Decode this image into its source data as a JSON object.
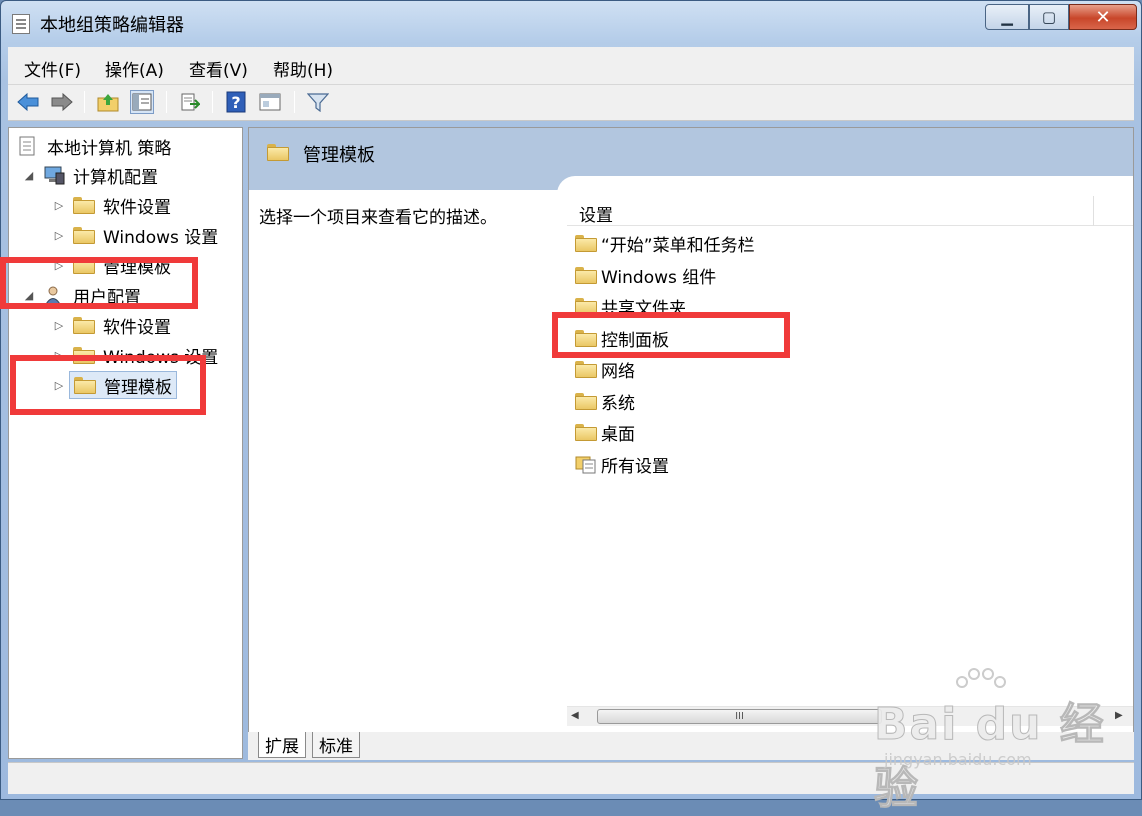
{
  "window": {
    "title": "本地组策略编辑器",
    "minimize_glyph": "▁",
    "maximize_glyph": "▢",
    "close_glyph": "✕"
  },
  "menubar": {
    "items": [
      "文件(F)",
      "操作(A)",
      "查看(V)",
      "帮助(H)"
    ]
  },
  "toolbar": {
    "icons": [
      "back-arrow-icon",
      "forward-arrow-icon",
      "up-folder-icon",
      "show-hide-tree-icon",
      "export-list-icon",
      "help-icon",
      "properties-icon",
      "filter-icon"
    ]
  },
  "tree": {
    "root": "本地计算机 策略",
    "computer_config": "计算机配置",
    "computer_children": [
      "软件设置",
      "Windows 设置",
      "管理模板"
    ],
    "user_config": "用户配置",
    "user_children": [
      "软件设置",
      "Windows 设置",
      "管理模板"
    ]
  },
  "details": {
    "header_title": "管理模板",
    "description": "选择一个项目来查看它的描述。",
    "column_header": "设置",
    "items": [
      "“开始”菜单和任务栏",
      "Windows 组件",
      "共享文件夹",
      "控制面板",
      "网络",
      "系统",
      "桌面",
      "所有设置"
    ]
  },
  "scrollbar": {
    "thumb_grip": "III",
    "left_arrow": "◀",
    "right_arrow": "▶"
  },
  "tabs": [
    "扩展",
    "标准"
  ],
  "watermark": {
    "brand": "Bai du 经验",
    "sub": "jingyan.baidu.com"
  },
  "colors": {
    "highlight": "#f03a3a",
    "header_band": "#b2c6df"
  }
}
